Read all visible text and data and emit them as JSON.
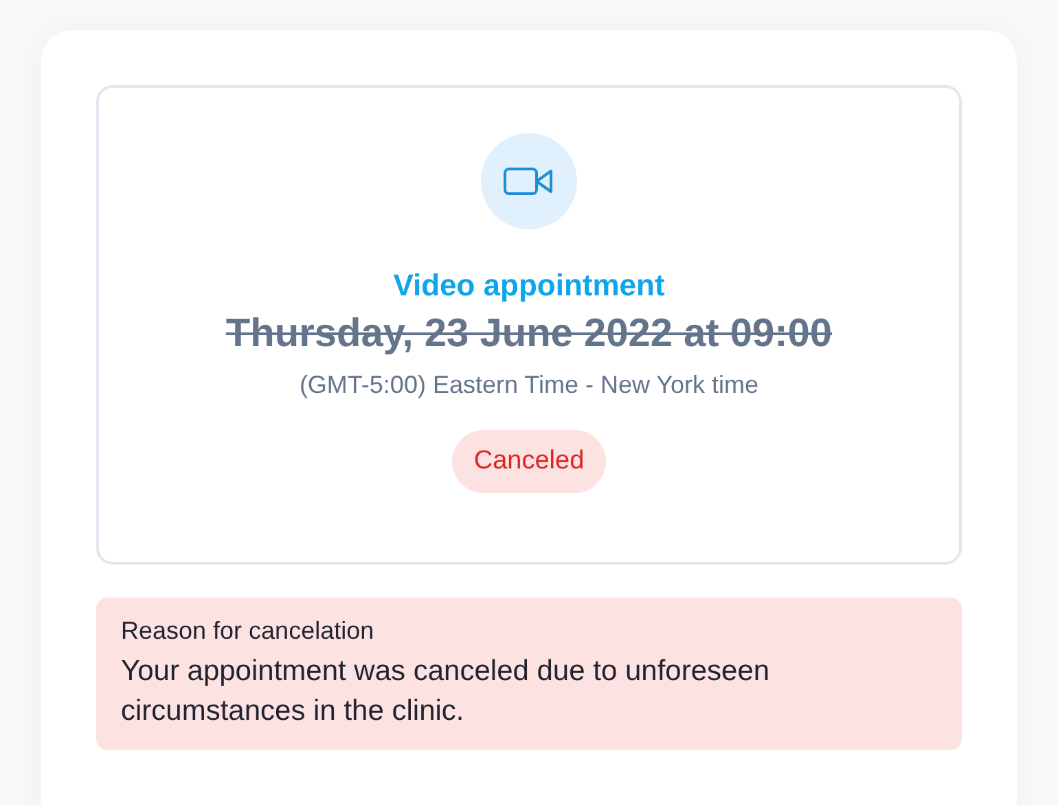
{
  "appointment": {
    "type": "Video appointment",
    "datetime": "Thursday, 23 June 2022 at 09:00",
    "timezone": "(GMT-5:00) Eastern Time - New York time",
    "status": {
      "kind": "canceled",
      "label": "Canceled"
    }
  },
  "cancelation": {
    "heading": "Reason for cancelation",
    "text": "Your appointment was canceled due to unforeseen circumstances in the clinic."
  }
}
